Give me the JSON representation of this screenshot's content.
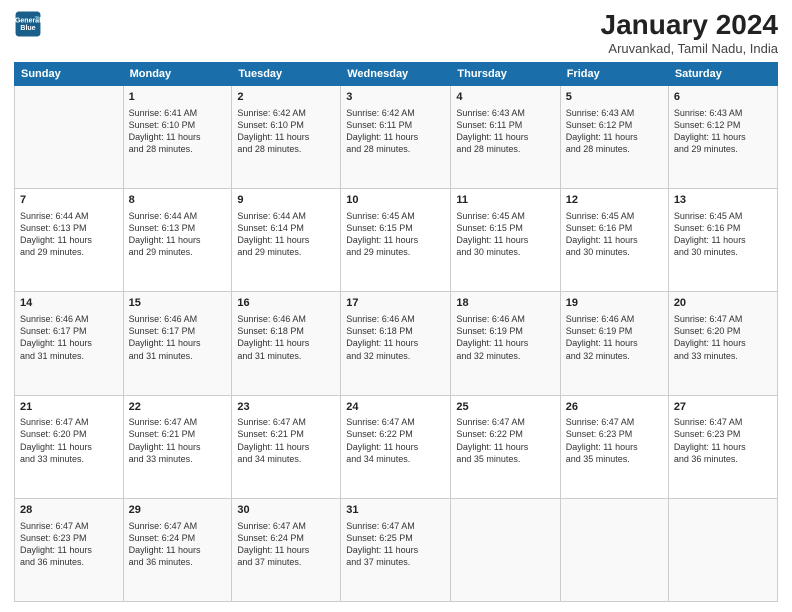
{
  "header": {
    "logo_line1": "General",
    "logo_line2": "Blue",
    "main_title": "January 2024",
    "sub_title": "Aruvankad, Tamil Nadu, India"
  },
  "columns": [
    "Sunday",
    "Monday",
    "Tuesday",
    "Wednesday",
    "Thursday",
    "Friday",
    "Saturday"
  ],
  "weeks": [
    [
      {
        "num": "",
        "info": ""
      },
      {
        "num": "1",
        "info": "Sunrise: 6:41 AM\nSunset: 6:10 PM\nDaylight: 11 hours\nand 28 minutes."
      },
      {
        "num": "2",
        "info": "Sunrise: 6:42 AM\nSunset: 6:10 PM\nDaylight: 11 hours\nand 28 minutes."
      },
      {
        "num": "3",
        "info": "Sunrise: 6:42 AM\nSunset: 6:11 PM\nDaylight: 11 hours\nand 28 minutes."
      },
      {
        "num": "4",
        "info": "Sunrise: 6:43 AM\nSunset: 6:11 PM\nDaylight: 11 hours\nand 28 minutes."
      },
      {
        "num": "5",
        "info": "Sunrise: 6:43 AM\nSunset: 6:12 PM\nDaylight: 11 hours\nand 28 minutes."
      },
      {
        "num": "6",
        "info": "Sunrise: 6:43 AM\nSunset: 6:12 PM\nDaylight: 11 hours\nand 29 minutes."
      }
    ],
    [
      {
        "num": "7",
        "info": "Sunrise: 6:44 AM\nSunset: 6:13 PM\nDaylight: 11 hours\nand 29 minutes."
      },
      {
        "num": "8",
        "info": "Sunrise: 6:44 AM\nSunset: 6:13 PM\nDaylight: 11 hours\nand 29 minutes."
      },
      {
        "num": "9",
        "info": "Sunrise: 6:44 AM\nSunset: 6:14 PM\nDaylight: 11 hours\nand 29 minutes."
      },
      {
        "num": "10",
        "info": "Sunrise: 6:45 AM\nSunset: 6:15 PM\nDaylight: 11 hours\nand 29 minutes."
      },
      {
        "num": "11",
        "info": "Sunrise: 6:45 AM\nSunset: 6:15 PM\nDaylight: 11 hours\nand 30 minutes."
      },
      {
        "num": "12",
        "info": "Sunrise: 6:45 AM\nSunset: 6:16 PM\nDaylight: 11 hours\nand 30 minutes."
      },
      {
        "num": "13",
        "info": "Sunrise: 6:45 AM\nSunset: 6:16 PM\nDaylight: 11 hours\nand 30 minutes."
      }
    ],
    [
      {
        "num": "14",
        "info": "Sunrise: 6:46 AM\nSunset: 6:17 PM\nDaylight: 11 hours\nand 31 minutes."
      },
      {
        "num": "15",
        "info": "Sunrise: 6:46 AM\nSunset: 6:17 PM\nDaylight: 11 hours\nand 31 minutes."
      },
      {
        "num": "16",
        "info": "Sunrise: 6:46 AM\nSunset: 6:18 PM\nDaylight: 11 hours\nand 31 minutes."
      },
      {
        "num": "17",
        "info": "Sunrise: 6:46 AM\nSunset: 6:18 PM\nDaylight: 11 hours\nand 32 minutes."
      },
      {
        "num": "18",
        "info": "Sunrise: 6:46 AM\nSunset: 6:19 PM\nDaylight: 11 hours\nand 32 minutes."
      },
      {
        "num": "19",
        "info": "Sunrise: 6:46 AM\nSunset: 6:19 PM\nDaylight: 11 hours\nand 32 minutes."
      },
      {
        "num": "20",
        "info": "Sunrise: 6:47 AM\nSunset: 6:20 PM\nDaylight: 11 hours\nand 33 minutes."
      }
    ],
    [
      {
        "num": "21",
        "info": "Sunrise: 6:47 AM\nSunset: 6:20 PM\nDaylight: 11 hours\nand 33 minutes."
      },
      {
        "num": "22",
        "info": "Sunrise: 6:47 AM\nSunset: 6:21 PM\nDaylight: 11 hours\nand 33 minutes."
      },
      {
        "num": "23",
        "info": "Sunrise: 6:47 AM\nSunset: 6:21 PM\nDaylight: 11 hours\nand 34 minutes."
      },
      {
        "num": "24",
        "info": "Sunrise: 6:47 AM\nSunset: 6:22 PM\nDaylight: 11 hours\nand 34 minutes."
      },
      {
        "num": "25",
        "info": "Sunrise: 6:47 AM\nSunset: 6:22 PM\nDaylight: 11 hours\nand 35 minutes."
      },
      {
        "num": "26",
        "info": "Sunrise: 6:47 AM\nSunset: 6:23 PM\nDaylight: 11 hours\nand 35 minutes."
      },
      {
        "num": "27",
        "info": "Sunrise: 6:47 AM\nSunset: 6:23 PM\nDaylight: 11 hours\nand 36 minutes."
      }
    ],
    [
      {
        "num": "28",
        "info": "Sunrise: 6:47 AM\nSunset: 6:23 PM\nDaylight: 11 hours\nand 36 minutes."
      },
      {
        "num": "29",
        "info": "Sunrise: 6:47 AM\nSunset: 6:24 PM\nDaylight: 11 hours\nand 36 minutes."
      },
      {
        "num": "30",
        "info": "Sunrise: 6:47 AM\nSunset: 6:24 PM\nDaylight: 11 hours\nand 37 minutes."
      },
      {
        "num": "31",
        "info": "Sunrise: 6:47 AM\nSunset: 6:25 PM\nDaylight: 11 hours\nand 37 minutes."
      },
      {
        "num": "",
        "info": ""
      },
      {
        "num": "",
        "info": ""
      },
      {
        "num": "",
        "info": ""
      }
    ]
  ]
}
